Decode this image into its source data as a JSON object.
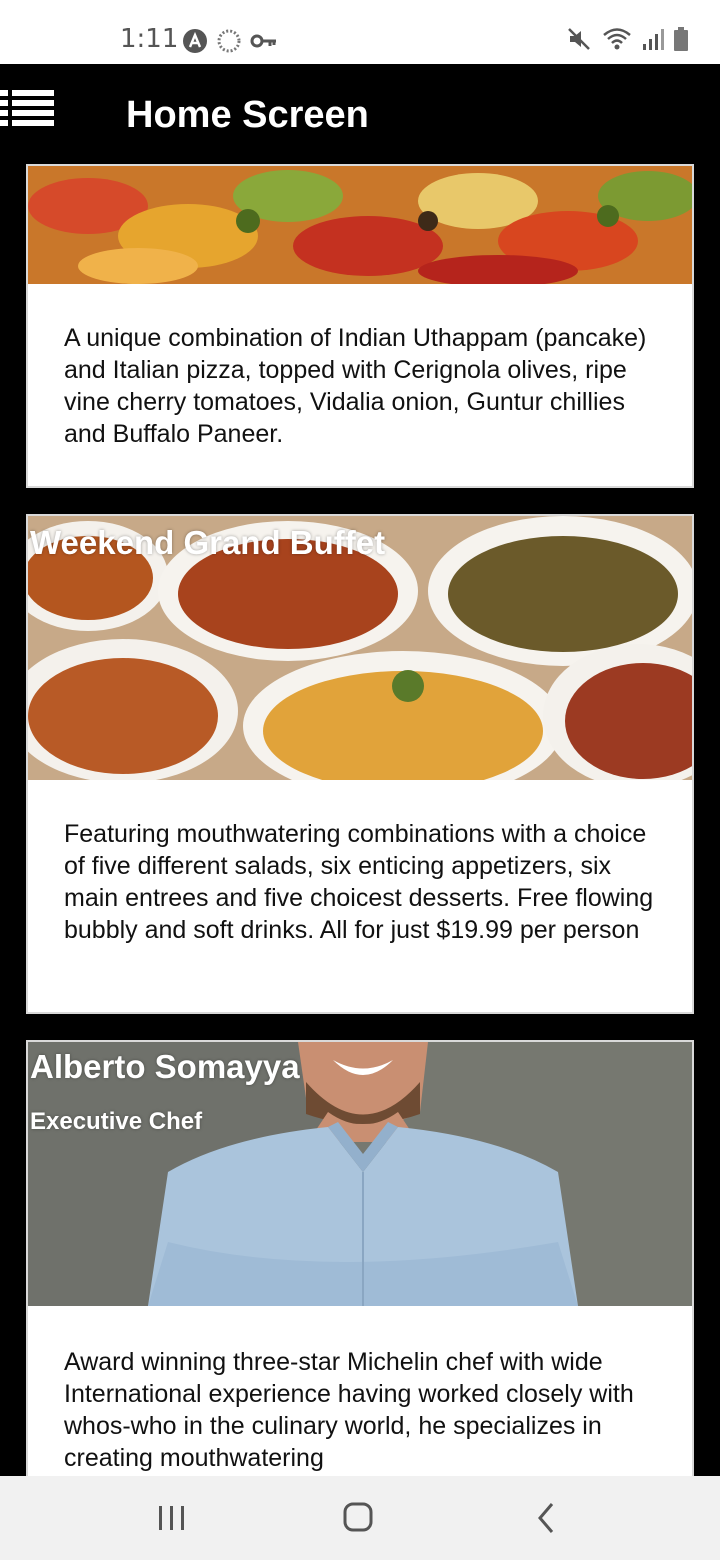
{
  "status_bar": {
    "time": "1:11",
    "left_icons": [
      "a-circle-icon",
      "sync-icon",
      "key-icon"
    ],
    "right_icons": [
      "mute-icon",
      "wifi-icon",
      "signal-icon",
      "battery-icon"
    ]
  },
  "app_bar": {
    "title": "Home Screen",
    "menu_icon": "hamburger-menu-icon"
  },
  "cards": [
    {
      "title": "",
      "description": "A unique combination of Indian Uthappam (pancake) and Italian pizza, topped with Cerignola olives, ripe vine cherry tomatoes, Vidalia onion, Guntur chillies and Buffalo Paneer."
    },
    {
      "title": "Weekend Grand Buffet",
      "description": "Featuring mouthwatering combinations with a choice of five different salads, six enticing appetizers, six main entrees and five choicest desserts. Free flowing bubbly and soft drinks. All for just $19.99 per person"
    },
    {
      "title": "Alberto Somayya",
      "subtitle": "Executive Chef",
      "description": "Award winning three-star Michelin chef with wide International experience having worked closely with whos-who in the culinary world, he specializes in creating mouthwatering"
    }
  ],
  "nav_bar": {
    "icons": [
      "recent-apps-icon",
      "home-icon",
      "back-icon"
    ]
  },
  "colors": {
    "app_bar": "#000000",
    "card_background": "#ffffff",
    "status_bar": "#ffffff",
    "nav_bar": "#f1f1f1"
  }
}
